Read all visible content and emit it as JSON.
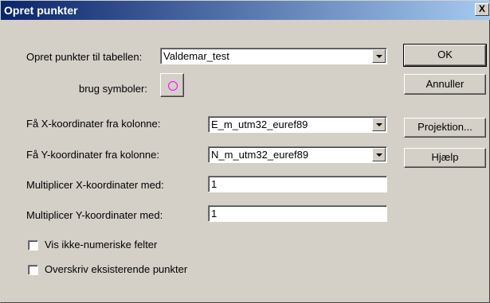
{
  "window": {
    "title": "Opret punkter",
    "close_label": "X"
  },
  "form": {
    "table_label": "Opret punkter til tabellen:",
    "table_value": "Valdemar_test",
    "symbols_label": "brug symboler:",
    "symbol_icon": "circle-symbol",
    "x_column_label": "Få X-koordinater fra kolonne:",
    "x_column_value": "E_m_utm32_euref89",
    "y_column_label": "Få Y-koordinater fra kolonne:",
    "y_column_value": "N_m_utm32_euref89",
    "multiply_x_label": "Multiplicer X-koordinater med:",
    "multiply_x_value": "1",
    "multiply_y_label": "Multiplicer Y-koordinater med:",
    "multiply_y_value": "1",
    "show_non_numeric_label": "Vis ikke-numeriske felter",
    "show_non_numeric_checked": false,
    "overwrite_label": "Overskriv eksisterende punkter",
    "overwrite_checked": false
  },
  "buttons": {
    "ok": "OK",
    "cancel": "Annuller",
    "projection": "Projektion...",
    "help": "Hjælp"
  },
  "colors": {
    "title_gradient_start": "#0a246a",
    "title_gradient_end": "#a6caf0",
    "symbol_color": "#ff00ff",
    "dialog_face": "#d4d0c8"
  }
}
